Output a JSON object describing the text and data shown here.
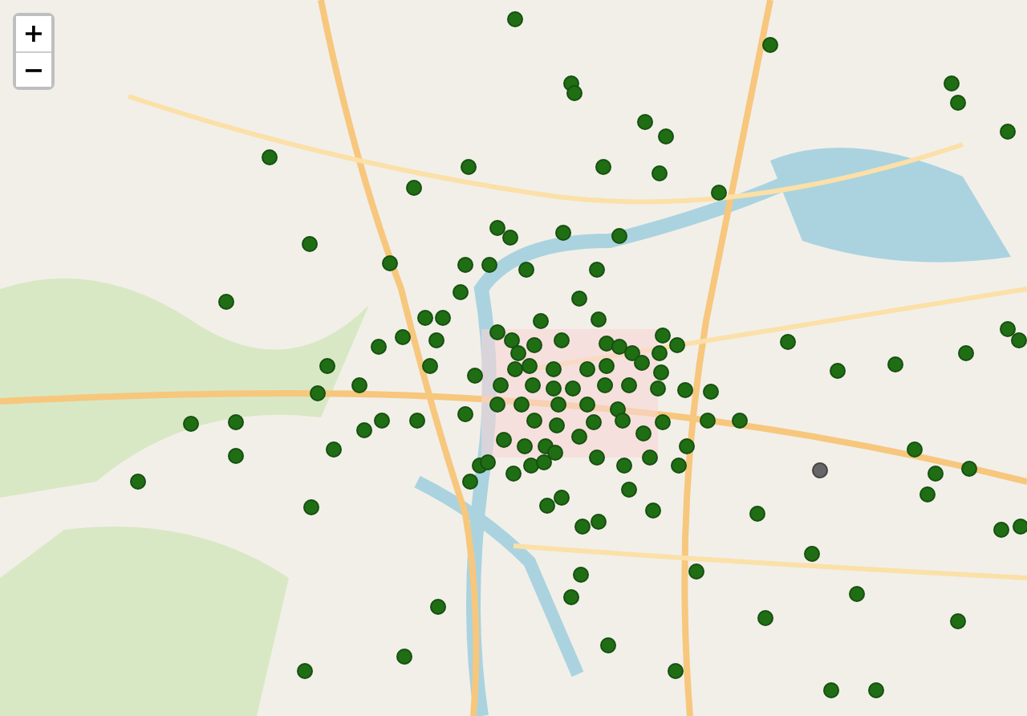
{
  "zoom_controls": [
    {
      "label": "+"
    },
    {
      "label": "−"
    }
  ]
}
